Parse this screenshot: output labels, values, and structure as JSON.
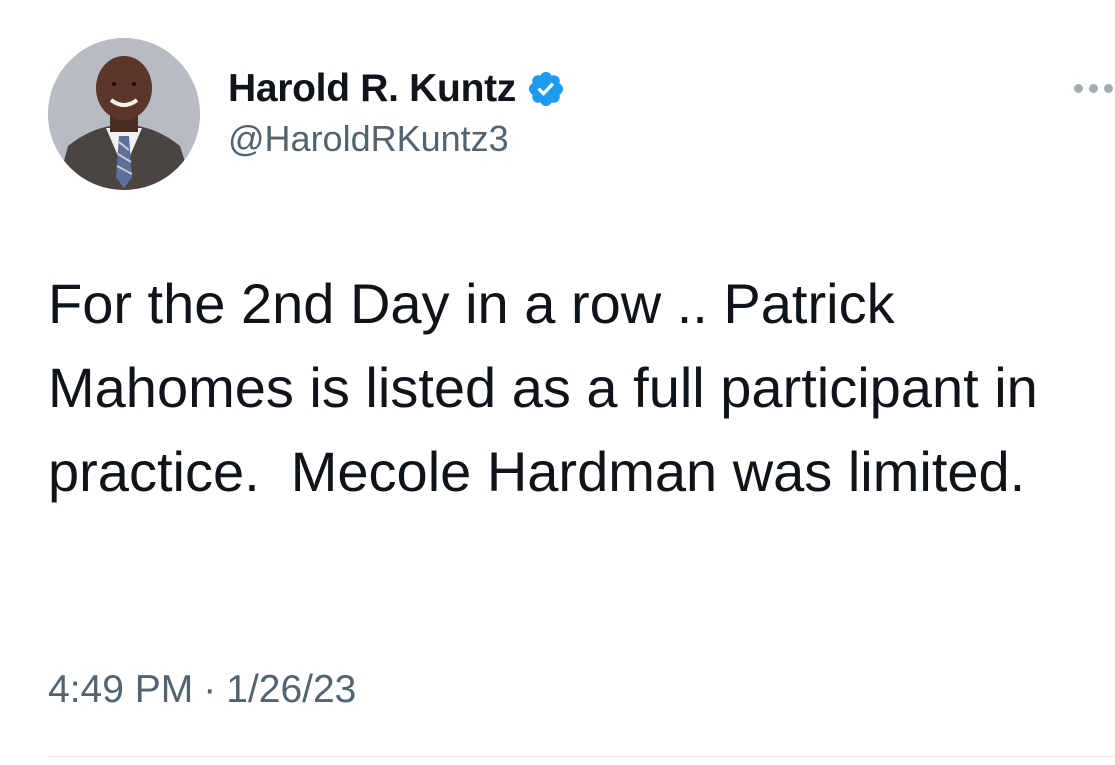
{
  "tweet": {
    "author": {
      "display_name": "Harold R. Kuntz",
      "handle": "@HaroldRKuntz3",
      "verified_icon": "verified-badge-icon",
      "verified_color": "#1d9bf0"
    },
    "text": "For the 2nd Day in a row .. Patrick Mahomes is listed as a full participant in practice.  Mecole Hardman was limited.",
    "time": "4:49 PM",
    "separator": "·",
    "date": "1/26/23",
    "menu_icon": "more-options-icon"
  },
  "colors": {
    "text_primary": "#0f1419",
    "text_secondary": "#536471",
    "accent": "#1d9bf0"
  }
}
